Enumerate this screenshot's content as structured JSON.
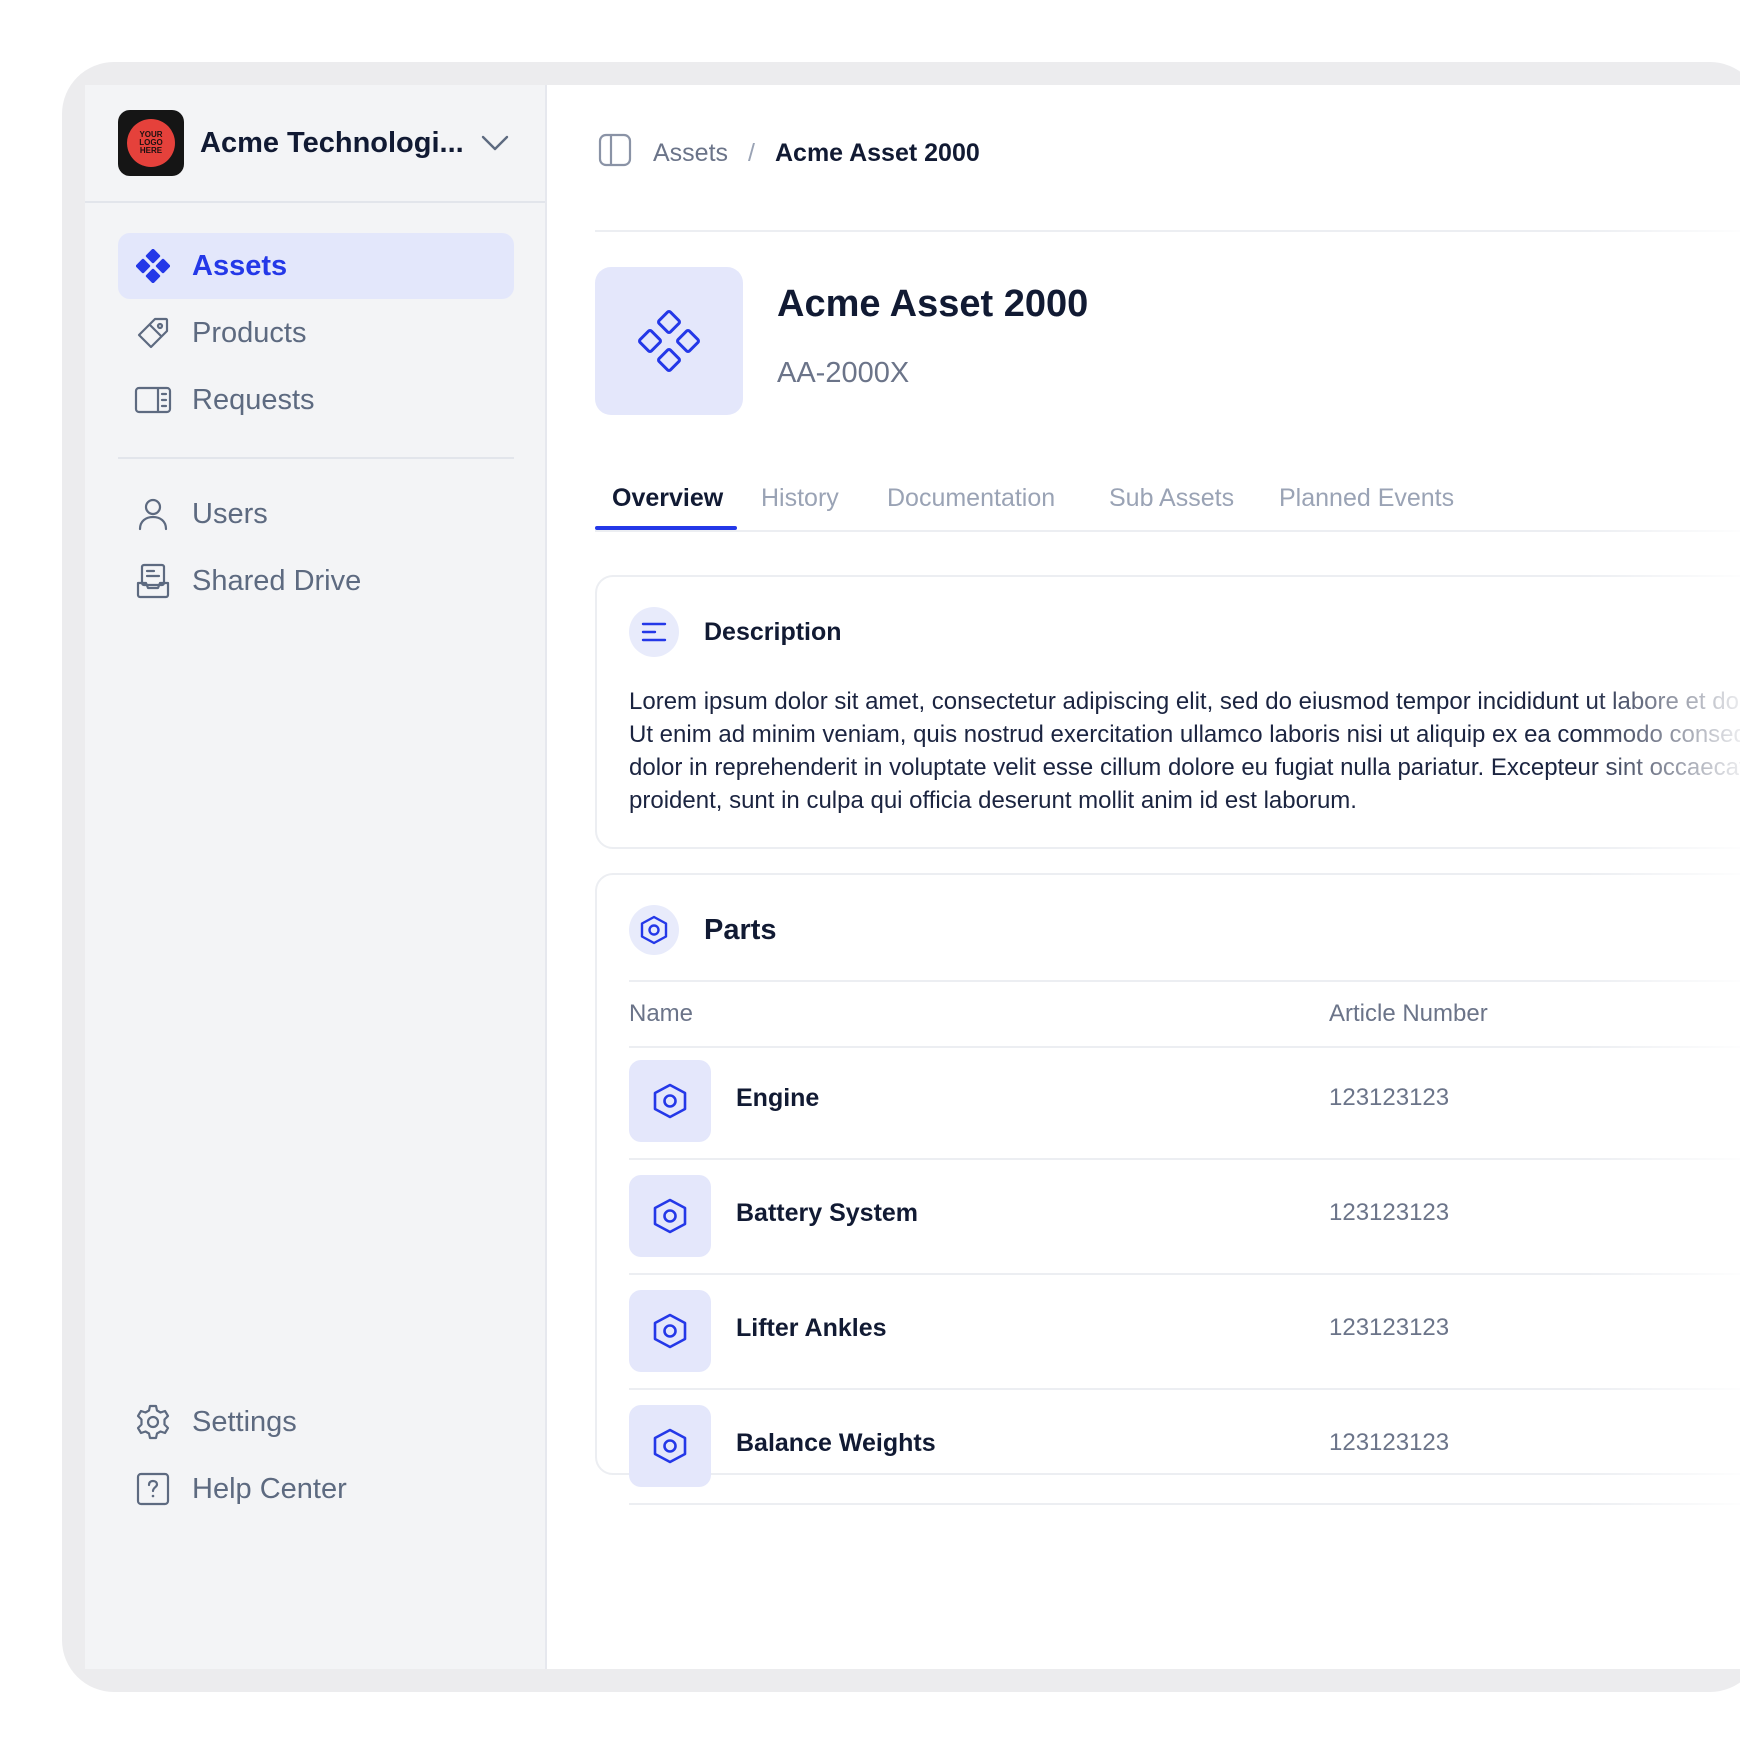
{
  "workspace": {
    "name": "Acme Technologi...",
    "logo_lines": [
      "YOUR",
      "LOGO",
      "HERE"
    ]
  },
  "sidebar": {
    "items": [
      {
        "label": "Assets",
        "icon": "assets-icon",
        "active": true
      },
      {
        "label": "Products",
        "icon": "tag-icon"
      },
      {
        "label": "Requests",
        "icon": "book-icon"
      },
      {
        "label": "Users",
        "icon": "user-icon"
      },
      {
        "label": "Shared Drive",
        "icon": "drive-icon"
      }
    ],
    "footer": [
      {
        "label": "Settings",
        "icon": "gear-icon"
      },
      {
        "label": "Help Center",
        "icon": "help-icon"
      }
    ]
  },
  "breadcrumb": {
    "parent": "Assets",
    "separator": "/",
    "current": "Acme Asset 2000"
  },
  "asset": {
    "title": "Acme Asset 2000",
    "code": "AA-2000X"
  },
  "tabs": [
    "Overview",
    "History",
    "Documentation",
    "Sub Assets",
    "Planned Events"
  ],
  "description": {
    "title": "Description",
    "lines": [
      "Lorem ipsum dolor sit amet, consectetur adipiscing elit, sed do eiusmod tempor incididunt ut labore et dolore magna aliqua.",
      "Ut enim ad minim veniam, quis nostrud exercitation ullamco laboris nisi ut aliquip ex ea commodo consequat. Duis aute irure",
      "dolor in reprehenderit in voluptate velit esse cillum dolore eu fugiat nulla pariatur. Excepteur sint occaecat cupidatat non",
      "proident, sunt in culpa qui officia deserunt mollit anim id est laborum."
    ]
  },
  "parts": {
    "title": "Parts",
    "columns": [
      "Name",
      "Article Number"
    ],
    "rows": [
      {
        "name": "Engine",
        "article": "123123123"
      },
      {
        "name": "Battery System",
        "article": "123123123"
      },
      {
        "name": "Lifter Ankles",
        "article": "123123123"
      },
      {
        "name": "Balance Weights",
        "article": "123123123"
      }
    ]
  },
  "colors": {
    "accent": "#2438e8",
    "accent_soft": "#e3e7fb",
    "sidebar_bg": "#f3f4f6",
    "text_primary": "#111a33",
    "text_muted": "#6b7489",
    "logo_red": "#e5413b"
  }
}
